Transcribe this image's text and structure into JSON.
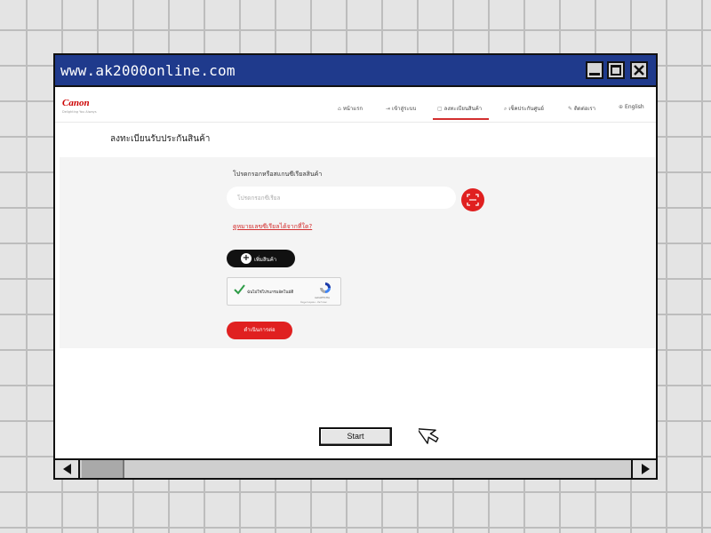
{
  "window": {
    "url": "www.ak2000online.com",
    "icons": {
      "minimize": "minimize-icon",
      "maximize": "maximize-icon",
      "close": "close-icon"
    }
  },
  "site": {
    "logo": "Canon",
    "tagline": "Delighting You Always",
    "nav": [
      {
        "label": "หน้าแรก",
        "icon": "home-icon"
      },
      {
        "label": "เข้าสู่ระบบ",
        "icon": "login-icon"
      },
      {
        "label": "ลงทะเบียนสินค้า",
        "icon": "register-icon",
        "active": true
      },
      {
        "label": "เช็คประกันศูนย์",
        "icon": "search-icon"
      },
      {
        "label": "ติดต่อเรา",
        "icon": "chat-icon"
      },
      {
        "label": "English",
        "icon": "globe-icon"
      }
    ],
    "accent_color": "#e02020"
  },
  "form": {
    "heading": "ลงทะเบียนรับประกันสินค้า",
    "serial_label": "โปรดกรอกหรือสแกนซีเรียลสินค้า",
    "serial_placeholder": "โปรดกรอกซีเรียล",
    "serial_value": "",
    "scan_icon": "scan-icon",
    "help_link": "ดูหมายเลขซีเรียลได้จากที่ใด?",
    "add_button": "เพิ่มสินค้า",
    "recaptcha": {
      "label": "ฉันไม่ใช่โปรแกรมอัตโนมัติ",
      "brand": "reCAPTCHA",
      "terms": "ข้อมูลส่วนบุคคล - ข้อกำหนด",
      "checked": true
    },
    "continue_button": "ดำเนินการต่อ"
  },
  "overlay": {
    "start_button": "Start",
    "cursor": "cursor-arrow-icon"
  },
  "scrollbar": {
    "left_icon": "arrow-left-icon",
    "right_icon": "arrow-right-icon"
  }
}
